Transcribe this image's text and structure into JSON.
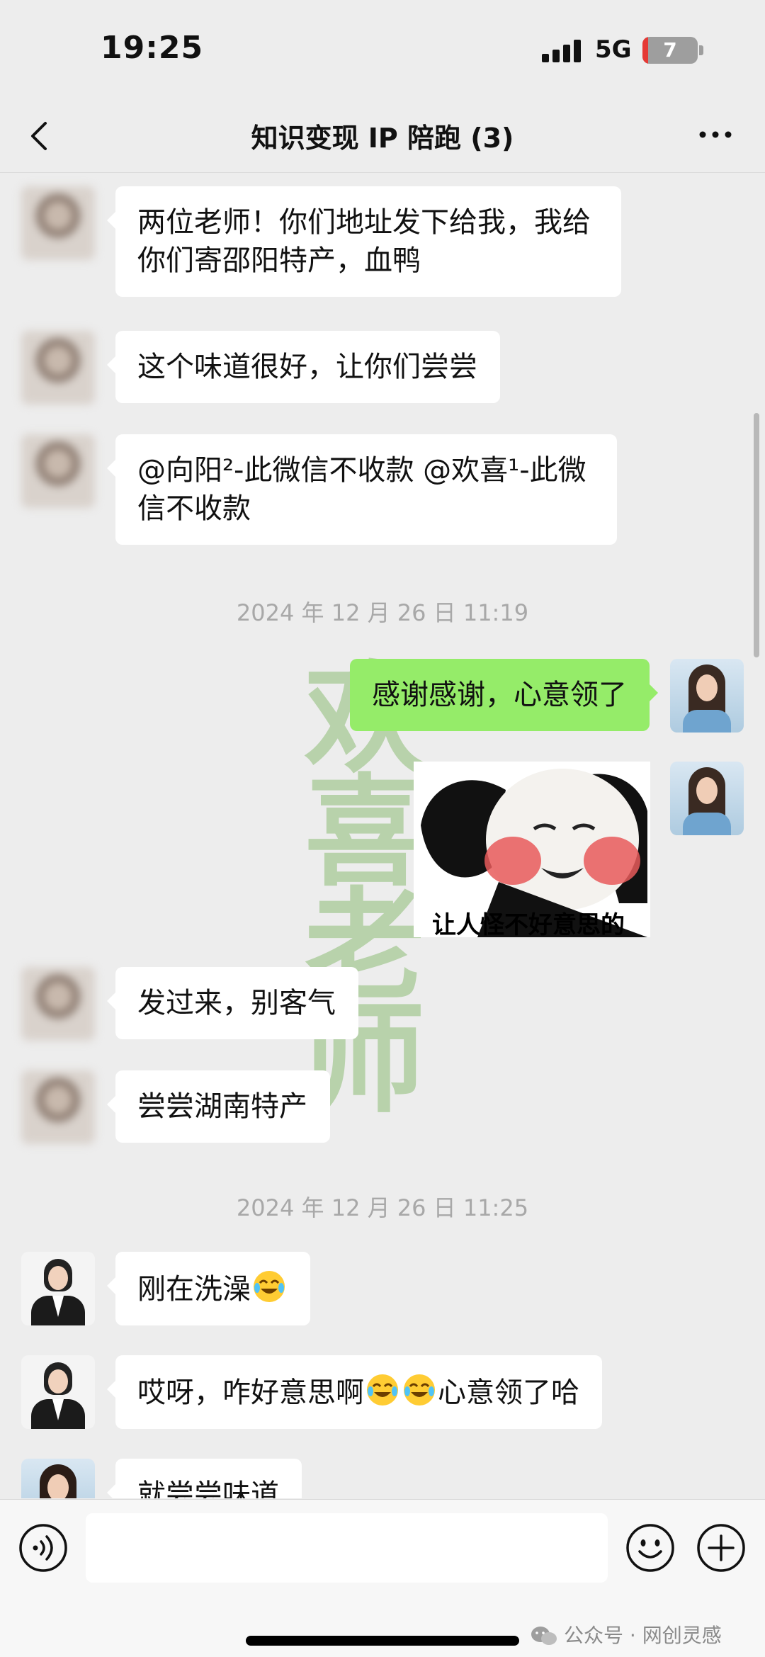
{
  "status_bar": {
    "time": "19:25",
    "network": "5G",
    "battery": "7"
  },
  "header": {
    "title": "知识变现 IP 陪跑 (3)"
  },
  "messages": [
    {
      "text": "两位老师！你们地址发下给我，我给你们寄邵阳特产，血鸭"
    },
    {
      "text": "这个味道很好，让你们尝尝"
    },
    {
      "text": "@向阳²-此微信不收款 @欢喜¹-此微信不收款"
    },
    {
      "timestamp": "2024 年 12 月 26 日 11:19"
    },
    {
      "text": "感谢感谢，心意领了"
    },
    {
      "sticker_caption": "让人怪不好意思的"
    },
    {
      "text": "发过来，别客气"
    },
    {
      "text": "尝尝湖南特产"
    },
    {
      "timestamp": "2024 年 12 月 26 日 11:25"
    },
    {
      "text": "刚在洗澡"
    },
    {
      "text_a": "哎呀，咋好意思啊",
      "text_b": "心意领了哈"
    },
    {
      "text": "就尝尝味道"
    }
  ],
  "watermark": [
    "欢",
    "喜",
    "老",
    "师"
  ],
  "input_bar": {
    "placeholder": ""
  },
  "footer": {
    "source": "公众号 · 网创灵感"
  },
  "colors": {
    "background": "#ededed",
    "self_bubble": "#95ec69",
    "other_bubble": "#ffffff"
  },
  "icons": [
    "back-icon",
    "more-icon",
    "voice-icon",
    "emoji-icon",
    "plus-icon",
    "wechat-icon"
  ]
}
